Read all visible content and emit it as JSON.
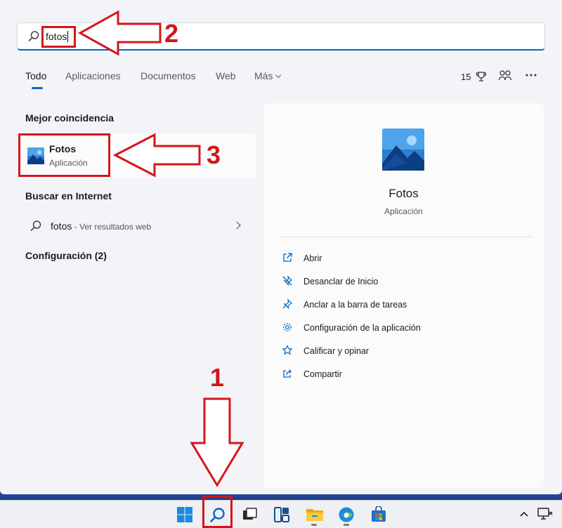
{
  "search": {
    "query": "fotos"
  },
  "tabs": [
    {
      "label": "Todo",
      "active": true
    },
    {
      "label": "Aplicaciones"
    },
    {
      "label": "Documentos"
    },
    {
      "label": "Web"
    },
    {
      "label": "Más"
    }
  ],
  "toolbar": {
    "points": "15"
  },
  "best_match": {
    "section_title": "Mejor coincidencia",
    "app_name": "Fotos",
    "app_type": "Aplicación"
  },
  "web": {
    "section_title": "Buscar en Internet",
    "query": "fotos",
    "suffix": " - Ver resultados web"
  },
  "settings": {
    "section_title": "Configuración (2)"
  },
  "preview": {
    "title": "Fotos",
    "subtitle": "Aplicación",
    "actions": [
      {
        "label": "Abrir",
        "icon": "open-icon"
      },
      {
        "label": "Desanclar de Inicio",
        "icon": "unpin-icon"
      },
      {
        "label": "Anclar a la barra de tareas",
        "icon": "pin-icon"
      },
      {
        "label": "Configuración de la aplicación",
        "icon": "gear-icon"
      },
      {
        "label": "Calificar y opinar",
        "icon": "star-icon"
      },
      {
        "label": "Compartir",
        "icon": "share-icon"
      }
    ]
  },
  "annotations": {
    "one": "1",
    "two": "2",
    "three": "3"
  },
  "colors": {
    "accent": "#0067c0",
    "annotation": "#d4161b"
  }
}
